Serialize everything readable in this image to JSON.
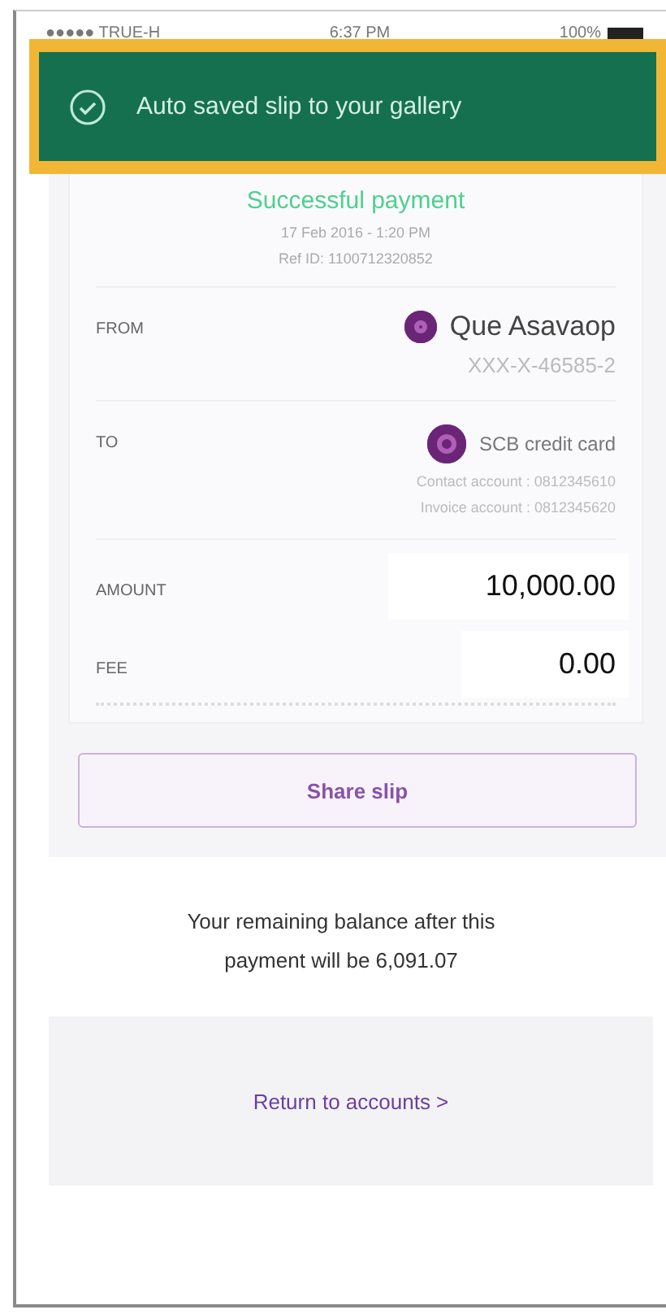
{
  "status_bar": {
    "carrier": "●●●●● TRUE-H",
    "time": "6:37 PM",
    "battery": "100%"
  },
  "toast": {
    "message": "Auto saved slip to your gallery"
  },
  "receipt": {
    "status": "Successful payment",
    "date": "17 Feb 2016 - 1:20 PM",
    "ref": "Ref ID: 1100712320852",
    "from": {
      "label": "FROM",
      "name": "Que Asavaop",
      "account": "XXX-X-46585-2"
    },
    "to": {
      "label": "TO",
      "name": "SCB credit card",
      "details": [
        "Contact account : 0812345610",
        "Invoice account : 0812345620"
      ]
    },
    "amounts": [
      {
        "label": "AMOUNT",
        "value": "10,000.00"
      },
      {
        "label": "FEE",
        "value": "0.00"
      }
    ]
  },
  "share_button": "Share slip",
  "balance_note": "Your remaining balance after this payment  will be 6,091.07",
  "return_link": "Return to accounts >"
}
